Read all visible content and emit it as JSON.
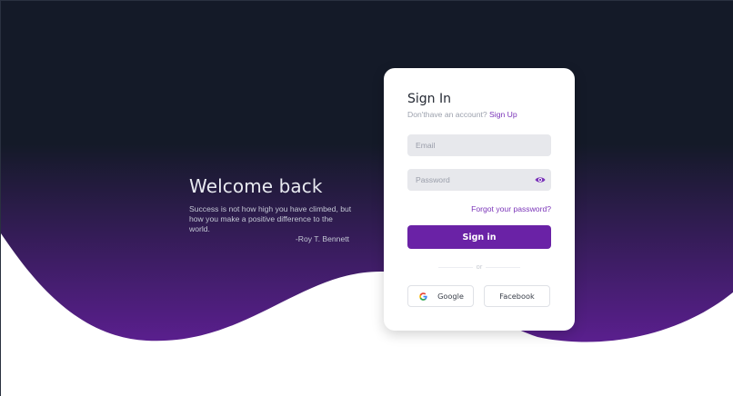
{
  "welcome": {
    "title": "Welcome back",
    "quote": "Success is not how high you have climbed, but how you make a positive difference to the world.",
    "author": "-Roy T. Bennett"
  },
  "signin": {
    "title": "Sign In",
    "no_account": "Don'thave an account?",
    "signup_link": "Sign Up",
    "email_placeholder": "Email",
    "password_placeholder": "Password",
    "forgot_link": "Forgot your password?",
    "submit_label": "Sign in",
    "divider_text": "or",
    "google_label": "Google",
    "facebook_label": "Facebook",
    "password_icon": "eye-icon",
    "google_icon": "google-icon"
  },
  "colors": {
    "background_dark": "#141a28",
    "gradient_purple": "#5a1f8e",
    "accent": "#7a34b8",
    "button": "#6a22a6",
    "card": "#ffffff"
  }
}
